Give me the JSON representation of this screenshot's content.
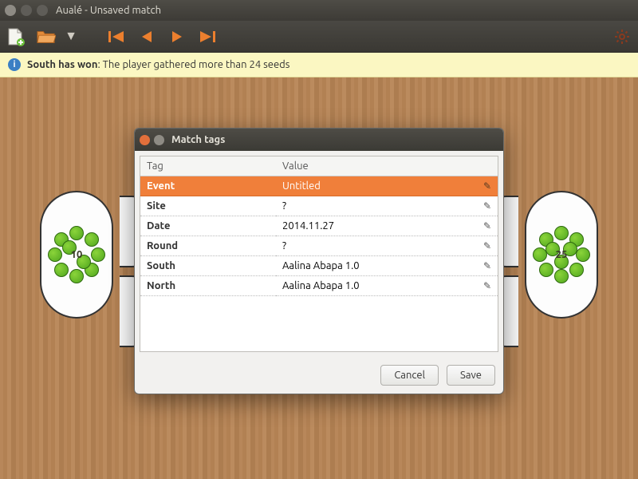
{
  "window": {
    "title": "Aualé - Unsaved match"
  },
  "toolbar": {
    "new": "New",
    "open": "Open",
    "nav_first": "First move",
    "nav_prev": "Previous",
    "nav_next": "Next",
    "nav_last": "Last",
    "settings": "Settings"
  },
  "info": {
    "strong": "South has won",
    "rest": ": The player gathered more than 24 seeds"
  },
  "board": {
    "left_house_count": "10",
    "right_house_count": "25"
  },
  "dialog": {
    "title": "Match tags",
    "col_tag": "Tag",
    "col_value": "Value",
    "rows": [
      {
        "tag": "Event",
        "value": "Untitled",
        "selected": true
      },
      {
        "tag": "Site",
        "value": "?"
      },
      {
        "tag": "Date",
        "value": "2014.11.27"
      },
      {
        "tag": "Round",
        "value": "?"
      },
      {
        "tag": "South",
        "value": "Aalina Abapa 1.0"
      },
      {
        "tag": "North",
        "value": "Aalina Abapa 1.0"
      }
    ],
    "cancel": "Cancel",
    "save": "Save"
  },
  "colors": {
    "accent": "#f07f3a",
    "close_btn": "#e26f3b",
    "min_btn": "#8e8b84"
  }
}
